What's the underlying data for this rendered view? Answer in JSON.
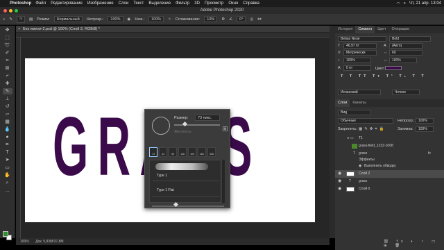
{
  "menubar": {
    "app": "Photoshop",
    "items": [
      "Файл",
      "Редактирование",
      "Изображение",
      "Слои",
      "Текст",
      "Выделение",
      "Фильтр",
      "3D",
      "Просмотр",
      "Окно",
      "Справка"
    ],
    "clock": "Чт, 21 апр. 13:04"
  },
  "window": {
    "title": "Adobe Photoshop 2020"
  },
  "options": {
    "brush_size": "73",
    "mode_label": "Режим:",
    "mode_value": "Нормальный",
    "opacity_label": "Непрозр.:",
    "opacity_value": "100%",
    "pressure_label": "Наж.:",
    "pressure_value": "100%",
    "smoothing_label": "Сглаживание:",
    "smoothing_value": "10%",
    "angle_value": "0°"
  },
  "document": {
    "tab_title": "Без имени-2.psd @ 100% (Слой 2, RGB/8) *",
    "canvas_text": "GRASS",
    "canvas_text_color": "#3b0a4a"
  },
  "status": {
    "zoom": "100%",
    "doc": "Док: 5,93M/37,8M"
  },
  "brush_popup": {
    "size_label": "Размер:",
    "size_value": "73 пикс.",
    "hardness_label": "Жесткость:",
    "presets": [
      "73",
      "43",
      "95",
      "108",
      "100",
      "280",
      "328"
    ],
    "items": [
      "Type 1",
      "Type 1 Flat"
    ]
  },
  "panels": {
    "top_tabs": [
      "История",
      "Символ",
      "Цвет",
      "Операции"
    ],
    "character": {
      "font": "Bebas Neue",
      "style": "Bold",
      "size": "46,97 пт",
      "leading": "(Авто)",
      "kerning": "Метрически",
      "tracking": "60",
      "vscale": "100%",
      "hscale": "100%",
      "baseline": "0 пт",
      "color_label": "Цвет:",
      "language": "Испанский",
      "antialias": "Четкое"
    },
    "layers_tabs": [
      "Слои",
      "Каналы"
    ],
    "layers_filter": "Вид",
    "blend_mode": "Обычные",
    "opacity_label": "Непрозр.:",
    "opacity_value": "100%",
    "lock_label": "Закрепить:",
    "fill_label": "Заливка:",
    "fill_value": "100%",
    "layers": [
      {
        "name": "Т1"
      },
      {
        "name": "grass-field_1232-1008"
      },
      {
        "name": "grass"
      },
      {
        "name": "Эффекты"
      },
      {
        "name": "Выполнить обводку"
      },
      {
        "name": "Слой 2"
      },
      {
        "name": "grass"
      },
      {
        "name": "Слой 0"
      }
    ]
  }
}
